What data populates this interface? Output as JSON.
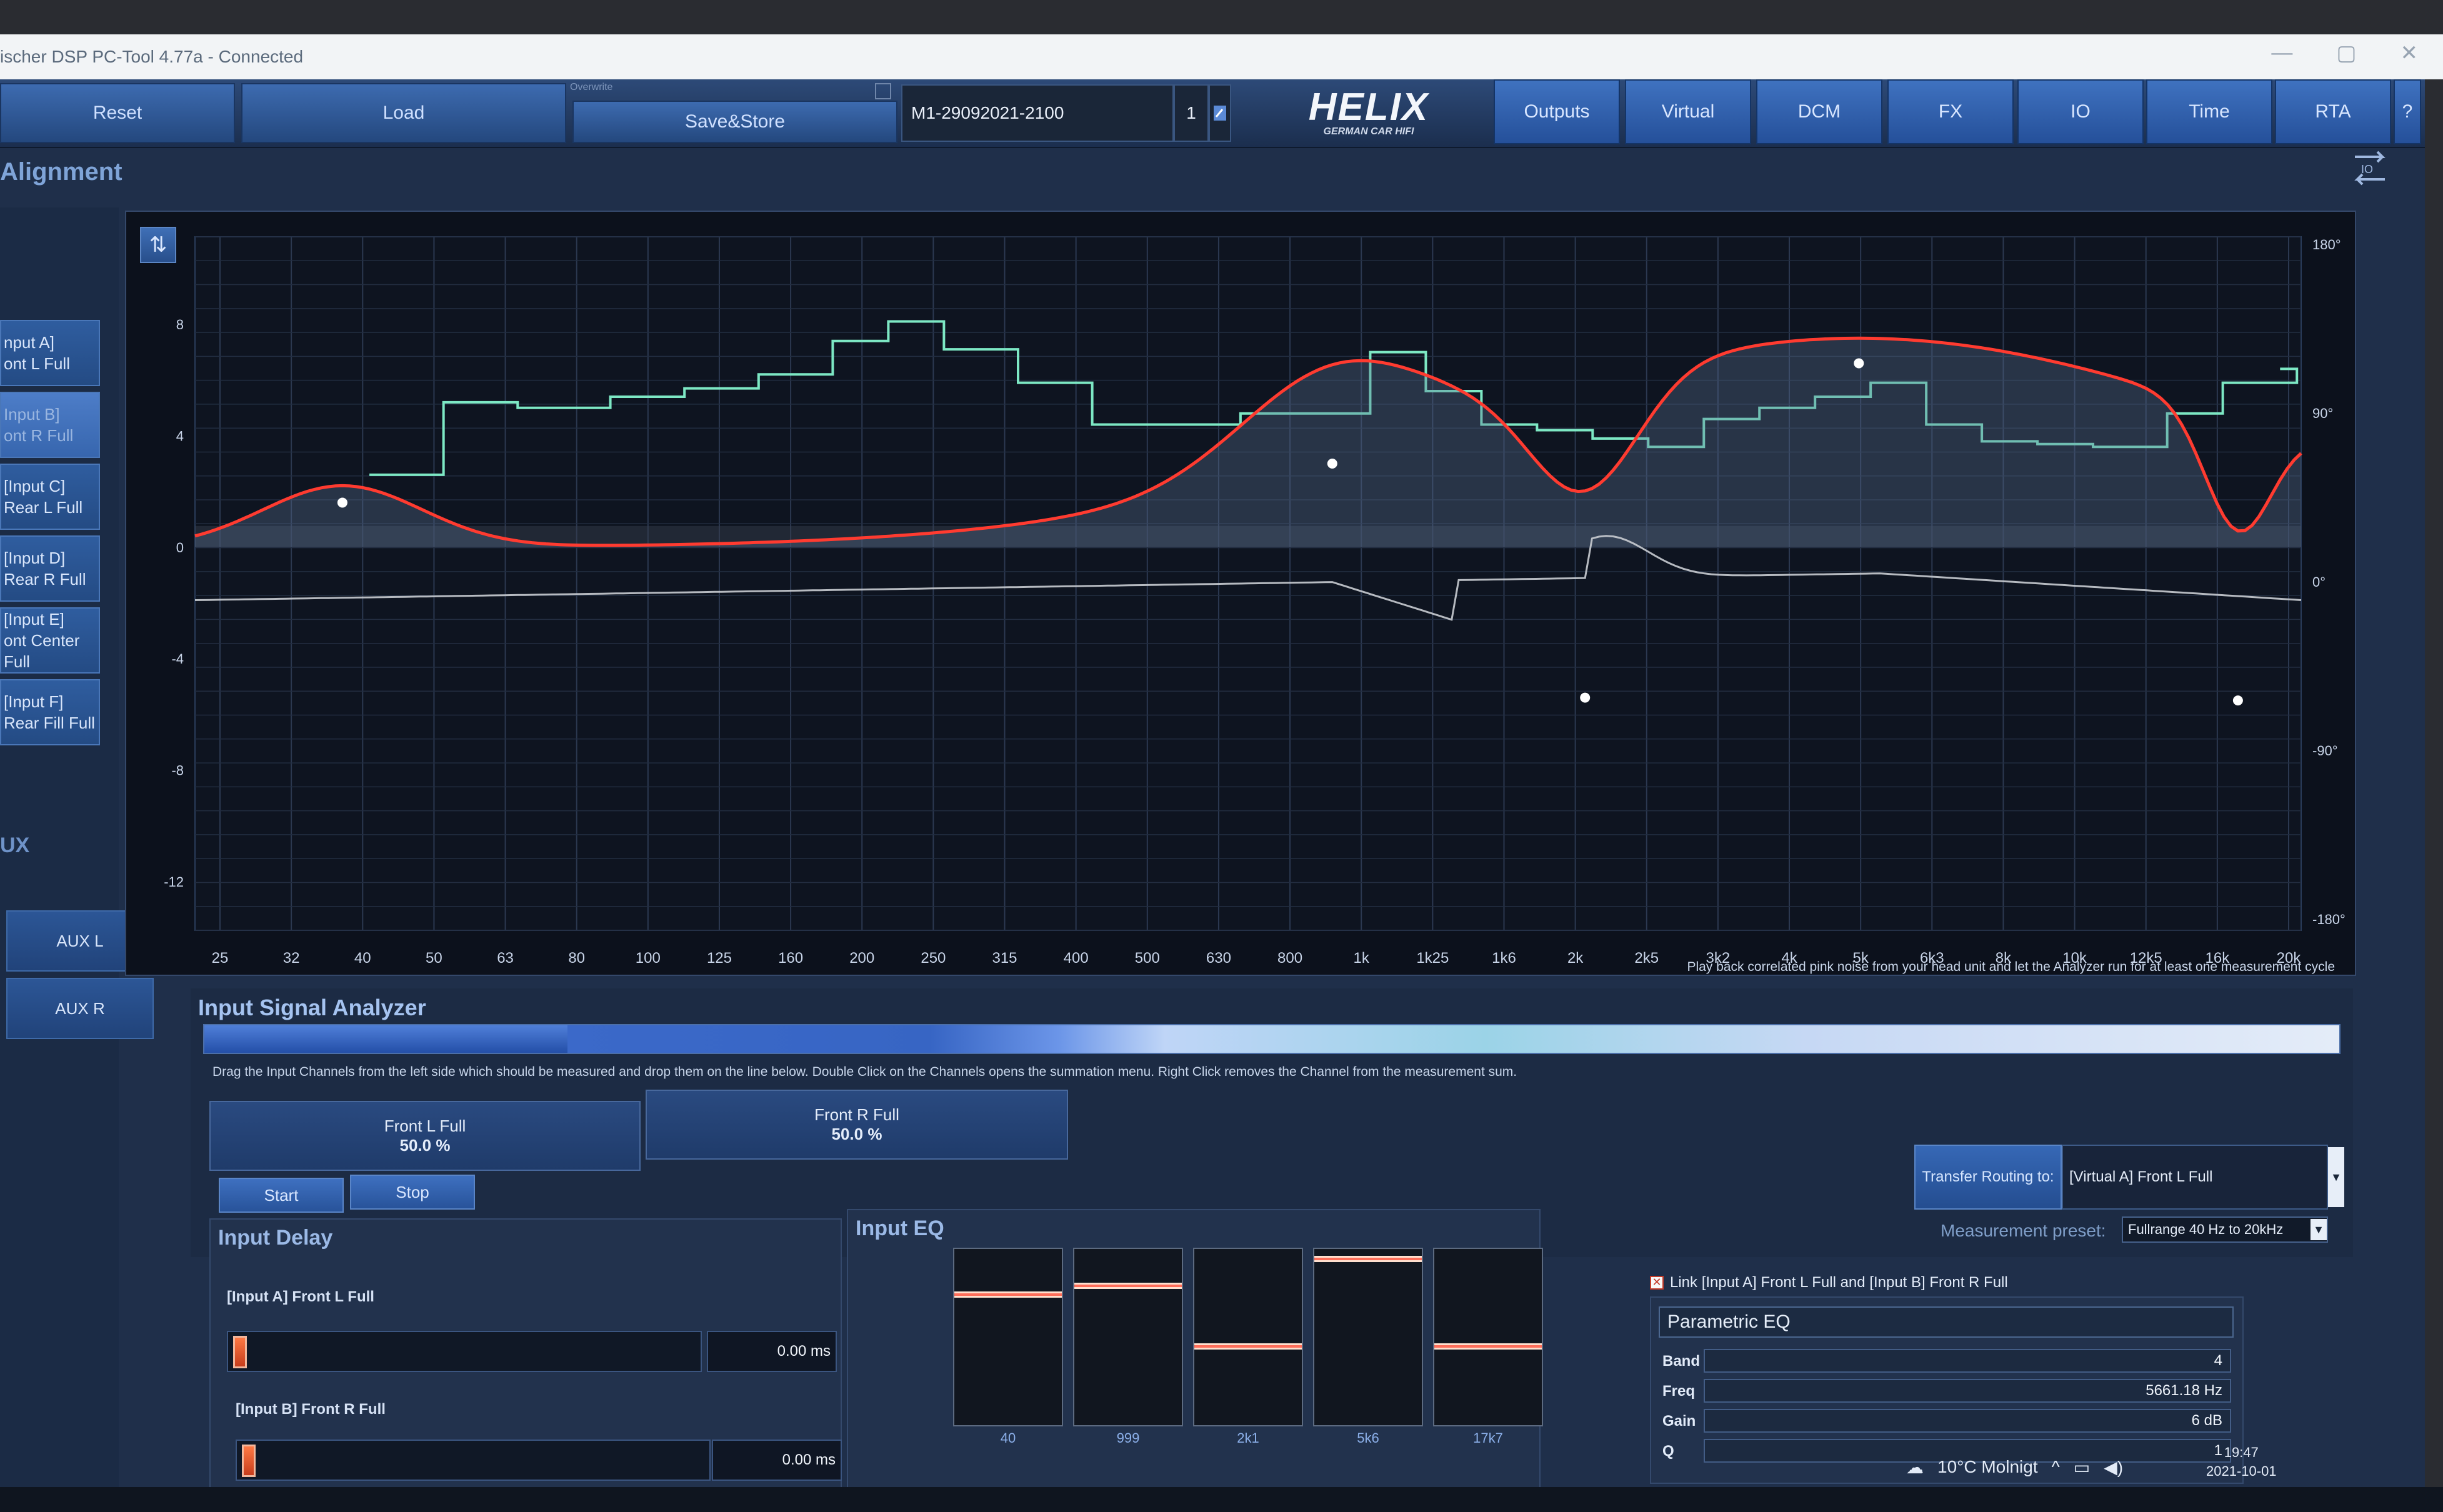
{
  "window": {
    "title": "ischer DSP PC-Tool 4.77a - Connected",
    "controls": [
      "—",
      "▢",
      "✕"
    ]
  },
  "toolbar": {
    "reset": "Reset",
    "load": "Load",
    "overwrite": "Overwrite",
    "save_store": "Save&Store",
    "preset_name": "M1-29092021-2100",
    "preset_slot": "1",
    "logo": "HELIX",
    "logo_sub": "GERMAN CAR HIFI",
    "nav": [
      "Outputs",
      "Virtual",
      "DCM",
      "FX",
      "IO",
      "Time",
      "RTA"
    ],
    "help": "?"
  },
  "section_title": "Alignment",
  "sidebar": {
    "inputs": [
      {
        "line1": "nput A]",
        "line2": "ont L Full"
      },
      {
        "line1": "Input B]",
        "line2": "ont R Full"
      },
      {
        "line1": "[Input C]",
        "line2": "Rear L Full"
      },
      {
        "line1": "[Input D]",
        "line2": "Rear R Full"
      },
      {
        "line1": "[Input E]",
        "line2": "ont Center Full"
      },
      {
        "line1": "[Input F]",
        "line2": "Rear Fill Full"
      }
    ],
    "aux_header": "UX",
    "aux": [
      "AUX L",
      "AUX R"
    ]
  },
  "graph": {
    "y_ticks_left": [
      "8",
      "4",
      "0",
      "-4",
      "-8",
      "-12"
    ],
    "y_ticks_right": [
      "180°",
      "90°",
      "0°",
      "-90°",
      "-180°"
    ],
    "x_ticks": [
      "25",
      "32",
      "40",
      "50",
      "63",
      "80",
      "100",
      "125",
      "160",
      "200",
      "250",
      "315",
      "400",
      "500",
      "630",
      "800",
      "1k",
      "1k25",
      "1k6",
      "2k",
      "2k5",
      "3k2",
      "4k",
      "5k",
      "6k3",
      "8k",
      "10k",
      "12k5",
      "16k",
      "20k"
    ],
    "hint": "Play back correlated pink noise from your head unit and let the Analyzer run for at least one measurement cycle",
    "colors": {
      "eq_curve": "#ff3b30",
      "rta": "#7de8c4",
      "phase": "#c9ccd2",
      "bg": "#0c111c"
    }
  },
  "analyzer": {
    "title": "Input Signal Analyzer",
    "progress": 0.17,
    "help": "Drag the Input Channels from the left side which should be measured and drop them on the line below. Double Click on the Channels opens the summation menu. Right Click removes the Channel from the measurement sum.",
    "channels": [
      {
        "name": "Front L Full",
        "share": "50.0 %"
      },
      {
        "name": "Front R Full",
        "share": "50.0 %"
      }
    ],
    "start": "Start",
    "stop": "Stop",
    "transfer_label": "Transfer Routing to:",
    "transfer_value": "[Virtual A] Front L Full",
    "preset_label": "Measurement preset:",
    "preset_value": "Fullrange 40 Hz to 20kHz"
  },
  "input_delay": {
    "title": "Input Delay",
    "rows": [
      {
        "label": "[Input A] Front L Full",
        "value": "0.00 ms"
      },
      {
        "label": "[Input B] Front R Full",
        "value": "0.00 ms"
      }
    ]
  },
  "input_eq": {
    "title": "Input EQ",
    "bands": [
      {
        "freq": "40",
        "level": 0.25
      },
      {
        "freq": "999",
        "level": 0.2
      },
      {
        "freq": "2k1",
        "level": 0.56
      },
      {
        "freq": "5k6",
        "level": 0.04
      },
      {
        "freq": "17k7",
        "level": 0.56
      }
    ]
  },
  "peq": {
    "link_label": "Link [Input A] Front L Full and [Input B] Front R Full",
    "mode": "Parametric EQ",
    "rows": [
      {
        "label": "Band",
        "value": "4"
      },
      {
        "label": "Freq",
        "value": "5661.18 Hz"
      },
      {
        "label": "Gain",
        "value": "6 dB"
      },
      {
        "label": "Q",
        "value": "1"
      }
    ]
  },
  "taskbar": {
    "weather": "10°C Molnigt",
    "time": "19:47",
    "date": "2021-10-01"
  }
}
